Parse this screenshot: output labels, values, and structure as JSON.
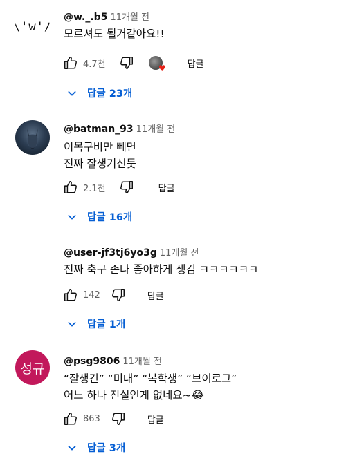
{
  "comments": [
    {
      "avatar_text": "\\'w'/",
      "handle": "@w._.b5",
      "time": "11개월 전",
      "lines": [
        "모르셔도 될거같아요!!"
      ],
      "likes": "4.7천",
      "reply_label": "답글",
      "replies_label": "답글 23개",
      "creator_heart": true
    },
    {
      "handle": "@batman_93",
      "time": "11개월 전",
      "lines": [
        "이목구비만 빼면",
        "진짜 잘생기신듯"
      ],
      "likes": "2.1천",
      "reply_label": "답글",
      "replies_label": "답글 16개"
    },
    {
      "handle": "@user-jf3tj6yo3g",
      "time": "11개월 전",
      "lines": [
        "진짜 축구 존나 좋아하게 생김 ㅋㅋㅋㅋㅋㅋ"
      ],
      "likes": "142",
      "reply_label": "답글",
      "replies_label": "답글 1개"
    },
    {
      "avatar_text": "성규",
      "handle": "@psg9806",
      "time": "11개월 전",
      "lines": [
        "“잘생긴” “미대” “복학생” “브이로그”",
        "어느 하나 진실인게 없네요~😂"
      ],
      "likes": "863",
      "reply_label": "답글",
      "replies_label": "답글 3개"
    }
  ],
  "colors": {
    "link_blue": "#065fd4",
    "secondary_text": "#606060",
    "avatar_pink": "#c2185b",
    "heart_red": "#e62117"
  },
  "icons": {
    "like": "thumbs-up-icon",
    "dislike": "thumbs-down-icon",
    "expand": "chevron-down-icon",
    "heart": "heart-icon"
  }
}
